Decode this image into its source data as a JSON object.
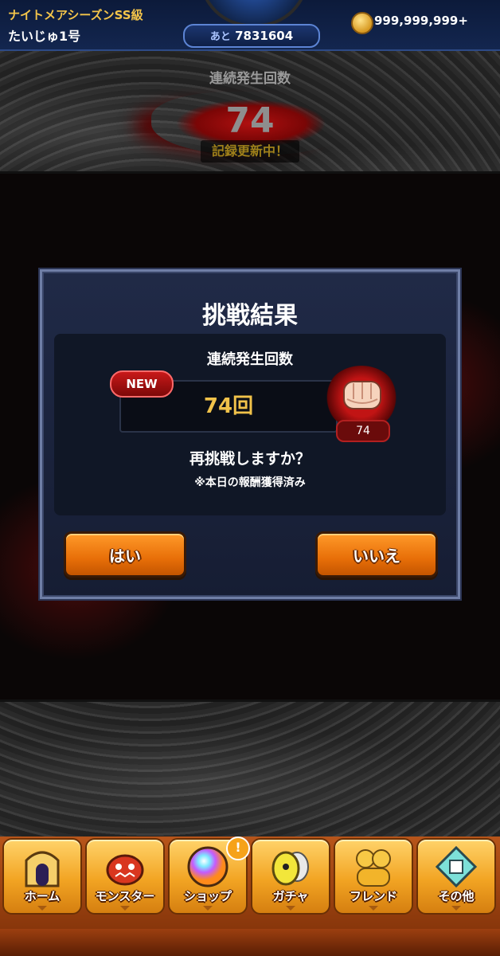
{
  "header": {
    "season": "ナイトメアシーズンSS級",
    "player_name": "たいじゅ1号",
    "remaining_label": "あと",
    "remaining_value": "7831604",
    "coins": "999,999,999+"
  },
  "counter": {
    "title": "連続発生回数",
    "value": "74",
    "record_badge": "記録更新中！"
  },
  "dialog": {
    "title": "挑戦結果",
    "label": "連続発生回数",
    "new_badge": "NEW",
    "value": "74回",
    "fist_count": "74",
    "question": "再挑戦しますか？",
    "note": "※本日の報酬獲得済み",
    "yes_button": "はい",
    "no_button": "いいえ"
  },
  "nav": {
    "items": [
      {
        "label": "ホーム",
        "icon": "home-icon"
      },
      {
        "label": "モンスター",
        "icon": "monster-icon"
      },
      {
        "label": "ショップ",
        "icon": "shop-orb-icon"
      },
      {
        "label": "ガチャ",
        "icon": "gacha-egg-icon"
      },
      {
        "label": "フレンド",
        "icon": "friend-icon"
      },
      {
        "label": "その他",
        "icon": "other-icon"
      }
    ],
    "shop_alert": "!"
  },
  "colors": {
    "accent_orange": "#e86f08",
    "dialog_bg": "#202a47",
    "gold_text": "#f1c24a"
  }
}
